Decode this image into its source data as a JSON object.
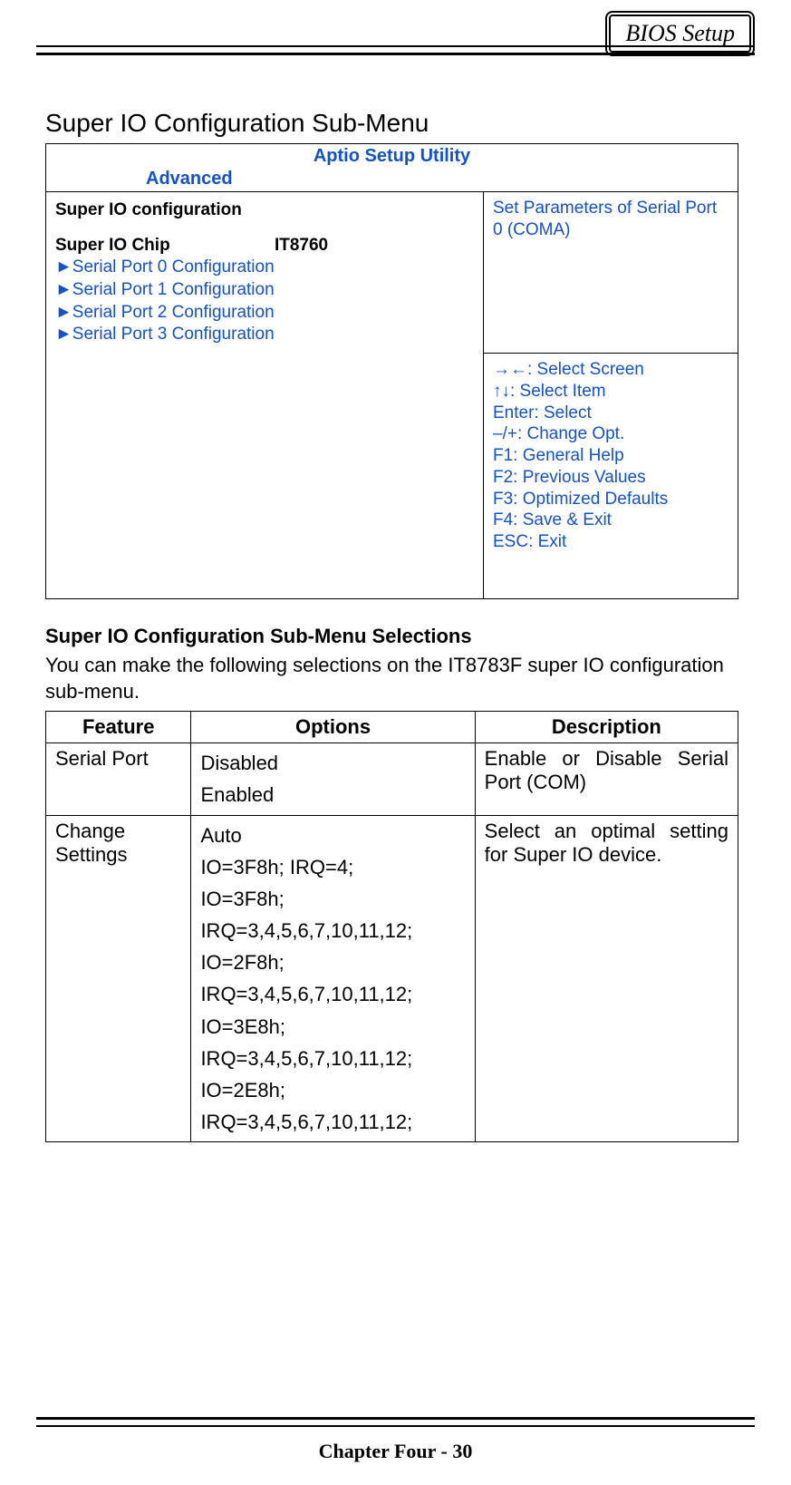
{
  "corner_label": "BIOS Setup",
  "page_heading": "Super IO Configuration Sub-Menu",
  "bios": {
    "utility_title": "Aptio Setup Utility",
    "active_menu": "Advanced",
    "section_title": "Super IO configuration",
    "chip_label": "Super IO Chip",
    "chip_value": "IT8760",
    "items": [
      "►Serial Port 0 Configuration",
      "►Serial Port 1 Configuration",
      "►Serial Port 2 Configuration",
      "►Serial Port 3 Configuration"
    ],
    "help_text": "Set Parameters of Serial Port 0 (COMA)",
    "keys": [
      "→←: Select Screen",
      "↑↓: Select Item",
      "Enter: Select",
      "–/+: Change Opt.",
      "F1: General Help",
      "F2: Previous Values",
      "F3: Optimized Defaults",
      "F4: Save & Exit",
      "ESC: Exit"
    ]
  },
  "selections_heading": "Super IO Configuration Sub-Menu Selections",
  "selections_intro": "You can make the following selections on the IT8783F super IO configuration sub-menu.",
  "table": {
    "headers": {
      "feature": "Feature",
      "options": "Options",
      "description": "Description"
    },
    "rows": [
      {
        "feature": "Serial Port",
        "options": "Disabled\nEnabled",
        "description": "Enable or Disable Serial Port (COM)"
      },
      {
        "feature": "Change Settings",
        "options": "Auto\nIO=3F8h; IRQ=4;\nIO=3F8h;\nIRQ=3,4,5,6,7,10,11,12;\nIO=2F8h;\nIRQ=3,4,5,6,7,10,11,12;\nIO=3E8h;\nIRQ=3,4,5,6,7,10,11,12;\nIO=2E8h;\nIRQ=3,4,5,6,7,10,11,12;",
        "description": "Select an optimal setting for Super IO device."
      }
    ]
  },
  "footer": "Chapter Four - 30"
}
